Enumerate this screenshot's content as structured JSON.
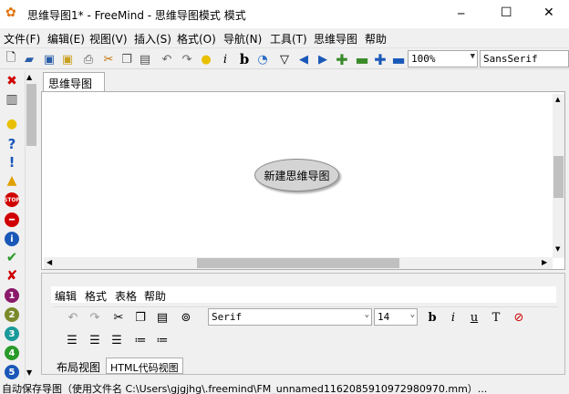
{
  "window": {
    "title": "思维导图1* - FreeMind - 思维导图模式 模式",
    "min_glyph": "─",
    "max_glyph": "☐",
    "close_glyph": "✕"
  },
  "menu": [
    "文件(F)",
    "编辑(E)",
    "视图(V)",
    "插入(S)",
    "格式(O)",
    "导航(N)",
    "工具(T)",
    "思维导图",
    "帮助"
  ],
  "toolbar": {
    "zoom": "100%",
    "font": "SansSerif"
  },
  "tabs": [
    "思维导图1*"
  ],
  "node": {
    "text": "新建思维导图"
  },
  "editor": {
    "menu": [
      "编辑",
      "格式",
      "表格",
      "帮助"
    ],
    "font": "Serif",
    "size": "14",
    "tabs": [
      "布局视图",
      "HTML代码视图"
    ]
  },
  "status": "自动保存导图（使用文件名 C:\\Users\\gjgjhg\\.freemind\\FM_unnamed1162085910972980970.mm）..."
}
